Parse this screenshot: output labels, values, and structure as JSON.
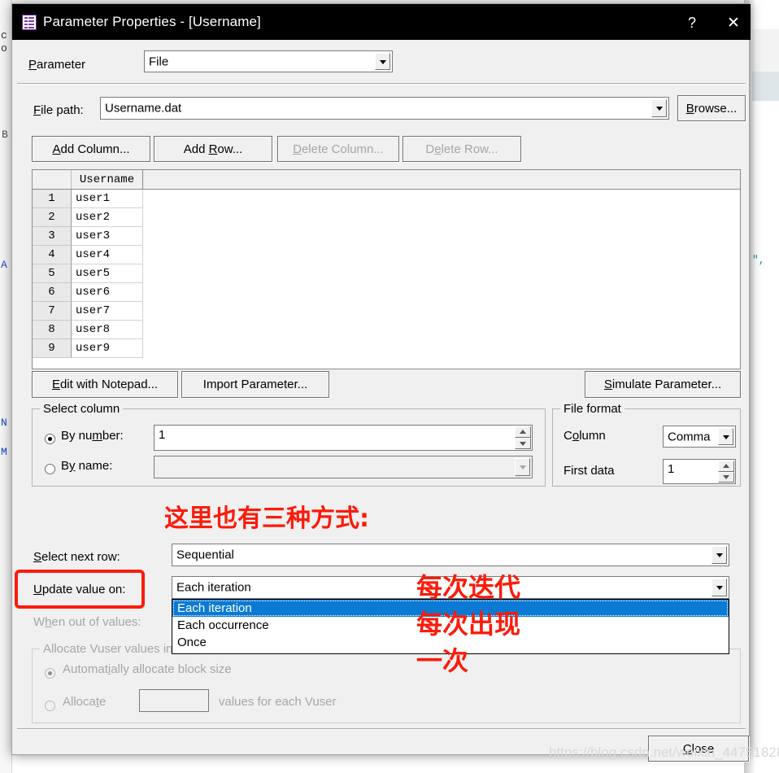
{
  "window": {
    "title": "Parameter Properties - [Username]",
    "icon": "parameter-table-icon",
    "help_label": "?",
    "close_label": "✕"
  },
  "parameter_row": {
    "label": "Parameter",
    "value": "File"
  },
  "file_path_row": {
    "label": "File path:",
    "value": "Username.dat",
    "browse_label": "Browse..."
  },
  "table_toolbar": {
    "add_column": "Add Column...",
    "add_row": "Add Row...",
    "delete_column": "Delete Column...",
    "delete_row": "Delete Row..."
  },
  "table": {
    "column_header": "Username",
    "rows": [
      {
        "n": "1",
        "value": "user1"
      },
      {
        "n": "2",
        "value": "user2"
      },
      {
        "n": "3",
        "value": "user3"
      },
      {
        "n": "4",
        "value": "user4"
      },
      {
        "n": "5",
        "value": "user5"
      },
      {
        "n": "6",
        "value": "user6"
      },
      {
        "n": "7",
        "value": "user7"
      },
      {
        "n": "8",
        "value": "user8"
      },
      {
        "n": "9",
        "value": "user9"
      }
    ]
  },
  "action_buttons": {
    "edit_with_notepad": "Edit with Notepad...",
    "import_parameter": "Import Parameter...",
    "simulate_parameter": "Simulate Parameter..."
  },
  "select_column": {
    "title": "Select column",
    "by_number_label": "By number:",
    "by_number_value": "1",
    "by_number_selected": true,
    "by_name_label": "By name:",
    "by_name_value": "",
    "by_name_selected": false
  },
  "file_format": {
    "title": "File format",
    "column_label": "Column",
    "column_value": "Comma",
    "first_data_label": "First data",
    "first_data_value": "1"
  },
  "next_row": {
    "label": "Select next row:",
    "value": "Sequential"
  },
  "update_value": {
    "label": "Update value on:",
    "value": "Each iteration",
    "options": [
      "Each iteration",
      "Each occurrence",
      "Once"
    ],
    "selected_index": 0
  },
  "out_of_values": {
    "label": "When out of values:"
  },
  "allocate_group": {
    "title": "Allocate Vuser values in the Controller",
    "auto_label": "Automatically allocate block size",
    "auto_selected": true,
    "allocate_label": "Allocate",
    "allocate_value": "",
    "allocate_suffix": "values for each Vuser",
    "allocate_selected": false
  },
  "footer": {
    "close_label": "Close"
  },
  "annotations": {
    "three_ways": "这里也有三种方式:",
    "each_iteration_cn": "每次迭代",
    "each_occurrence_cn": "每次出现",
    "once_cn": "一次"
  },
  "watermark": {
    "text": "https://blog.csdn.net/weixin_44751828"
  },
  "background_code": {
    "line1": "c",
    "line2": "o",
    "line3": "B",
    "line4": "A",
    "line5": "N",
    "line6": "M",
    "line7": "\", ",
    "right_snippet": "\","
  },
  "colors": {
    "accent_blue": "#0a7ad4",
    "annotation_red": "#fb1b0b",
    "titlebar": "#000000",
    "dialog_face": "#f0f0f0"
  }
}
